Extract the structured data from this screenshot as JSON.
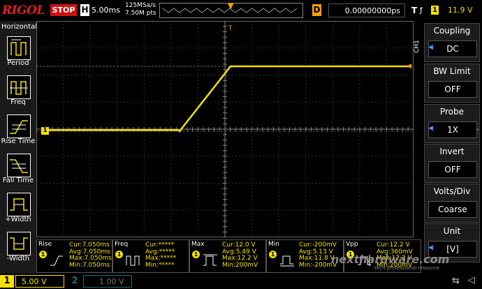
{
  "topbar": {
    "brand": "RIGOL",
    "run_state": "STOP",
    "timebase_key": "H",
    "timebase": "5.00ms",
    "sample_rate": "125MSa/s",
    "memory_depth": "7.50M pts",
    "delay_key": "D",
    "delay": "0.00000000ps",
    "trigger_key": "T",
    "trigger_source": "1",
    "trigger_level": "11.9 V"
  },
  "left_menu": {
    "title": "Horizontal",
    "items": [
      {
        "label": "Period",
        "icon": "period-icon"
      },
      {
        "label": "Freq",
        "icon": "frequency-icon"
      },
      {
        "label": "Rise Time",
        "icon": "rise-time-icon"
      },
      {
        "label": "Fall Time",
        "icon": "fall-time-icon"
      },
      {
        "label": "+Width",
        "icon": "positive-width-icon"
      },
      {
        "label": "-Width",
        "icon": "negative-width-icon"
      }
    ]
  },
  "right_menu": {
    "channel_tag": "CH1",
    "panels": [
      {
        "title": "Coupling",
        "value": "DC",
        "has_arrow": true
      },
      {
        "title": "BW Limit",
        "value": "OFF",
        "has_arrow": false
      },
      {
        "title": "Probe",
        "value": "1X",
        "has_arrow": true
      },
      {
        "title": "Invert",
        "value": "OFF",
        "has_arrow": false
      },
      {
        "title": "Volts/Div",
        "value": "Coarse",
        "has_arrow": false
      },
      {
        "title": "Unit",
        "value": "[V]",
        "has_arrow": true
      }
    ]
  },
  "measurements": [
    {
      "name": "Rise",
      "channel": "1",
      "icon": "rise-measure-icon",
      "cur": "Cur:7.050ms",
      "avg": "Avg:7.050ms",
      "max": "Max:7.050ms",
      "min": "Min:7.050ms"
    },
    {
      "name": "Freq",
      "channel": "1",
      "icon": "freq-measure-icon",
      "cur": "Cur:*****",
      "avg": "Avg:*****",
      "max": "Max:*****",
      "min": "Min:*****"
    },
    {
      "name": "Max",
      "channel": "1",
      "icon": "max-measure-icon",
      "cur": "Cur:12.0 V",
      "avg": "Avg:5.49 V",
      "max": "Max:12.2 V",
      "min": "Min:200mV"
    },
    {
      "name": "Min",
      "channel": "1",
      "icon": "min-measure-icon",
      "cur": "Cur:-200mV",
      "avg": "Avg:5.13 V",
      "max": "Max:11.8 V",
      "min": "Min:-200mV"
    },
    {
      "name": "Vpp",
      "channel": "1",
      "icon": "vpp-measure-icon",
      "cur": "Cur:12.2 V",
      "avg": "Avg:360mV",
      "max": "Max:12.2 V",
      "min": "Min:200mV"
    }
  ],
  "bottombar": {
    "ch1_label": "1",
    "ch1_scale": "5.00 V",
    "ch2_label": "2",
    "ch2_scale": "1.00 V"
  },
  "watermark": {
    "text": "nexthardware.com",
    "subtext": "tech-professional resource"
  },
  "colors": {
    "trace": "#f5e000",
    "trigger": "#f5a000",
    "stop": "#d01010",
    "ch2": "#1a6b73",
    "accent_blue": "#3aa0ff"
  }
}
